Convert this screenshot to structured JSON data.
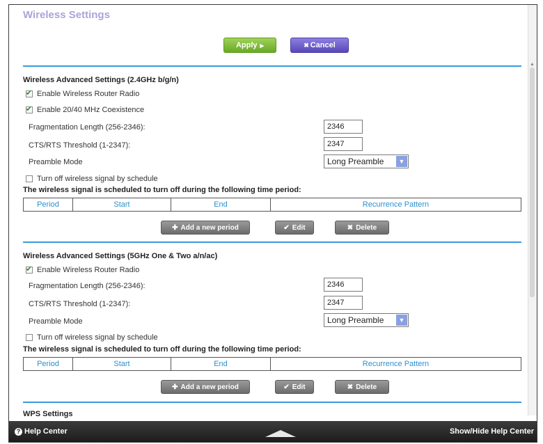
{
  "page_title": "Wireless Settings",
  "actions": {
    "apply": "Apply",
    "apply_icon": "▸",
    "cancel": "Cancel",
    "cancel_icon": "✖"
  },
  "section_24": {
    "title": "Wireless Advanced Settings (2.4GHz b/g/n)",
    "enable_radio": {
      "label": "Enable Wireless Router Radio",
      "checked": true
    },
    "coexistence": {
      "label": "Enable 20/40 MHz Coexistence",
      "checked": true
    },
    "frag_label": "Fragmentation Length (256-2346):",
    "frag_value": "2346",
    "rts_label": "CTS/RTS Threshold (1-2347):",
    "rts_value": "2347",
    "preamble_label": "Preamble Mode",
    "preamble_value": "Long Preamble",
    "schedule": {
      "label": "Turn off wireless signal by schedule",
      "checked": false
    },
    "schedule_note": "The wireless signal is scheduled to turn off during the following time period:",
    "columns": [
      "Period",
      "Start",
      "End",
      "Recurrence Pattern"
    ],
    "buttons": {
      "add": "Add a new period",
      "edit": "Edit",
      "delete": "Delete"
    }
  },
  "section_5": {
    "title": "Wireless Advanced Settings (5GHz One & Two a/n/ac)",
    "enable_radio": {
      "label": "Enable Wireless Router Radio",
      "checked": true
    },
    "frag_label": "Fragmentation Length (256-2346):",
    "frag_value": "2346",
    "rts_label": "CTS/RTS Threshold (1-2347):",
    "rts_value": "2347",
    "preamble_label": "Preamble Mode",
    "preamble_value": "Long Preamble",
    "schedule": {
      "label": "Turn off wireless signal by schedule",
      "checked": false
    },
    "schedule_note": "The wireless signal is scheduled to turn off during the following time period:",
    "columns": [
      "Period",
      "Start",
      "End",
      "Recurrence Pattern"
    ],
    "buttons": {
      "add": "Add a new period",
      "edit": "Edit",
      "delete": "Delete"
    }
  },
  "wps_title": "WPS Settings",
  "footer": {
    "help_center": "Help Center",
    "show_hide": "Show/Hide Help Center"
  },
  "colors": {
    "apply": "#7ab93a",
    "cancel": "#6b5dd3",
    "rule": "#3a9ad9",
    "table_text": "#2a8fd0",
    "footer": "#2b2b2b"
  }
}
